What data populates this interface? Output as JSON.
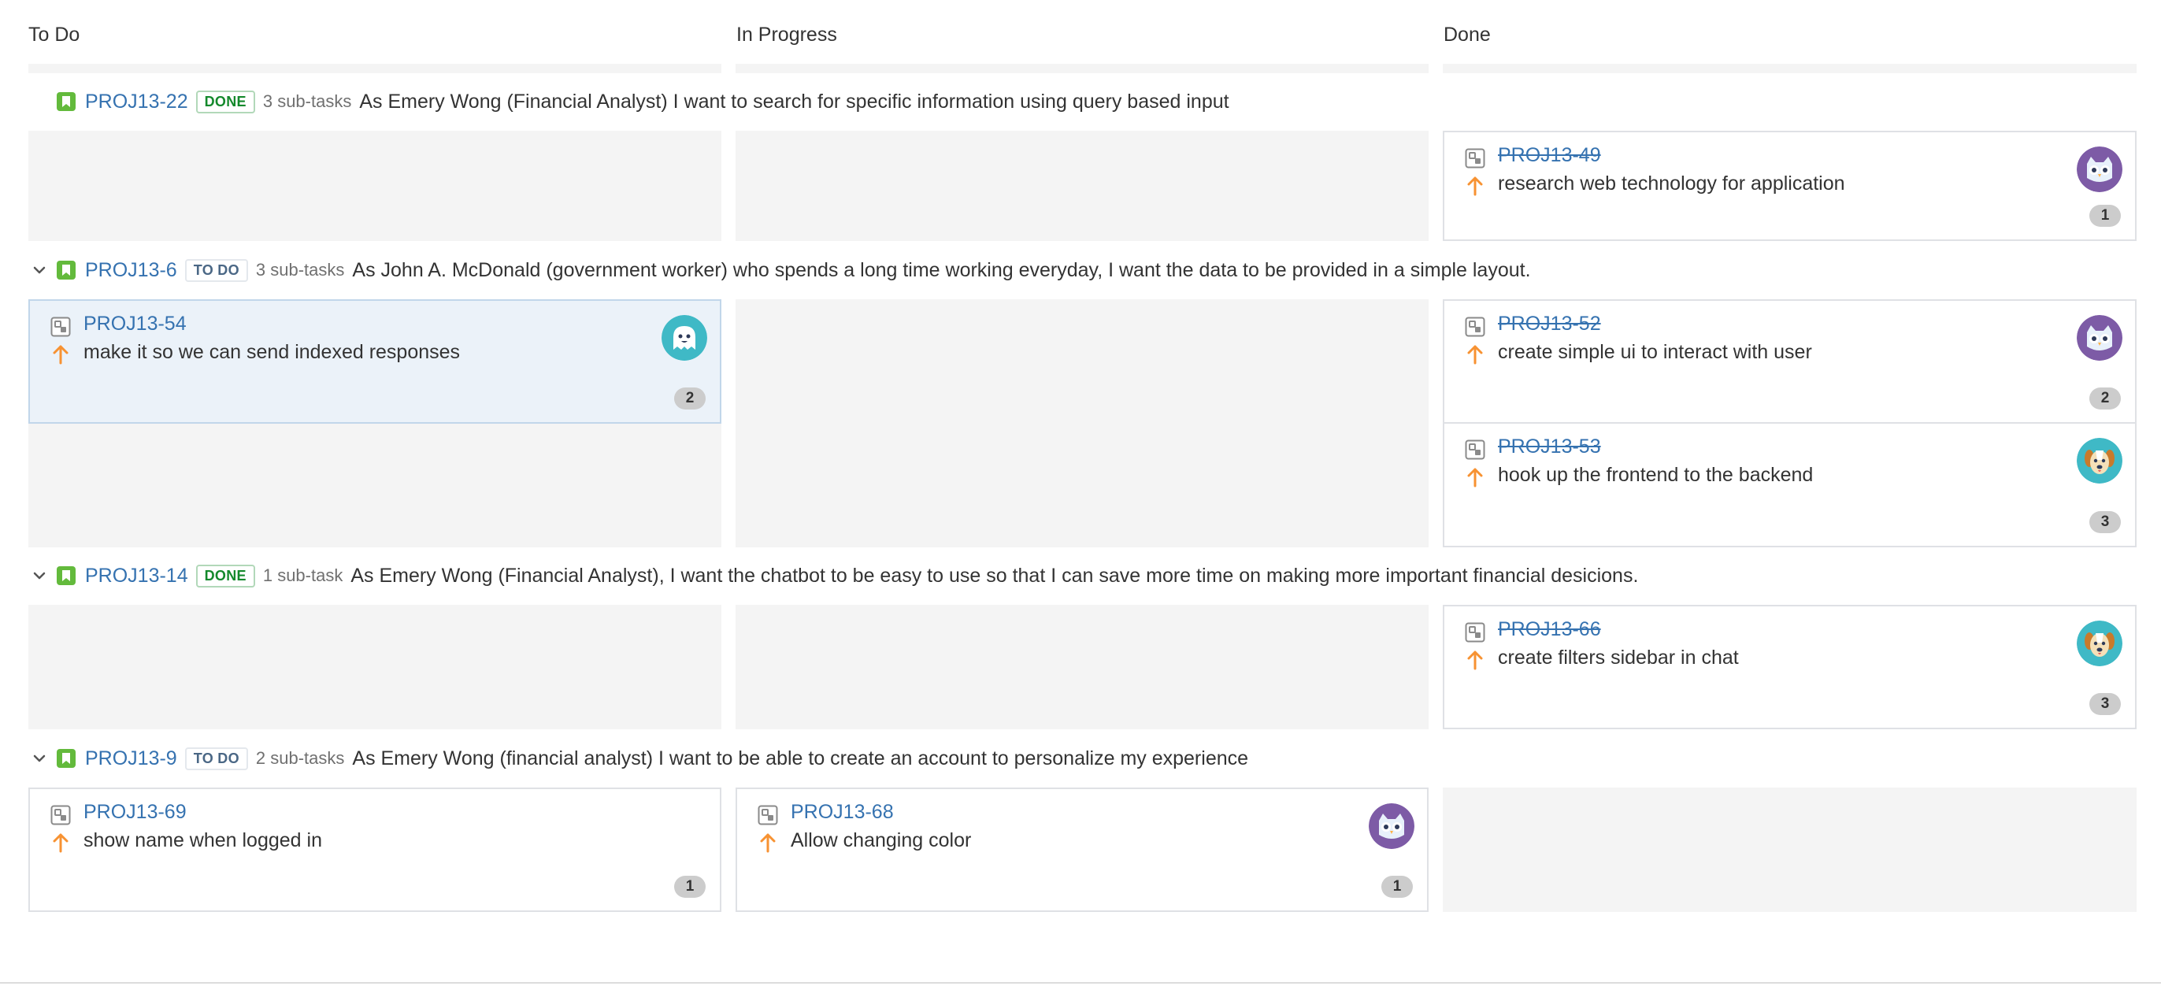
{
  "columns": [
    "To Do",
    "In Progress",
    "Done"
  ],
  "swimlanes": [
    {
      "key": "PROJ13-22",
      "status": "DONE",
      "subtasks": "3 sub-tasks",
      "summary": "As Emery Wong (Financial Analyst) I want to search for specific information using query based input",
      "cards": [
        {
          "key": "PROJ13-49",
          "summary": "research web technology for application",
          "estimate": "1",
          "column": "Done",
          "key_strikethrough": true,
          "avatar": "owl-avatar-purple"
        }
      ]
    },
    {
      "key": "PROJ13-6",
      "status": "TO DO",
      "subtasks": "3 sub-tasks",
      "summary": "As John A. McDonald (government worker) who spends a long time working everyday, I want the data to be provided in a simple layout.",
      "cards": [
        {
          "key": "PROJ13-54",
          "summary": "make it so we can send indexed responses",
          "estimate": "2",
          "column": "To Do",
          "key_strikethrough": false,
          "selected": true,
          "avatar": "ghost-avatar-teal"
        },
        {
          "key": "PROJ13-52",
          "summary": "create simple ui to interact with user",
          "estimate": "2",
          "column": "Done",
          "key_strikethrough": true,
          "avatar": "owl-avatar-purple"
        },
        {
          "key": "PROJ13-53",
          "summary": "hook up the frontend to the backend",
          "estimate": "3",
          "column": "Done",
          "key_strikethrough": true,
          "avatar": "dog-avatar-teal"
        }
      ]
    },
    {
      "key": "PROJ13-14",
      "status": "DONE",
      "subtasks": "1 sub-task",
      "summary": "As Emery Wong (Financial Analyst), I want the chatbot to be easy to use so that I can save more time on making more important financial desicions.",
      "cards": [
        {
          "key": "PROJ13-66",
          "summary": "create filters sidebar in chat",
          "estimate": "3",
          "column": "Done",
          "key_strikethrough": true,
          "avatar": "dog-avatar-teal"
        }
      ]
    },
    {
      "key": "PROJ13-9",
      "status": "TO DO",
      "subtasks": "2 sub-tasks",
      "summary": "As Emery Wong (financial analyst) I want to be able to create an account to personalize my experience",
      "cards": [
        {
          "key": "PROJ13-69",
          "summary": "show name when logged in",
          "estimate": "1",
          "column": "To Do",
          "key_strikethrough": false
        },
        {
          "key": "PROJ13-68",
          "summary": "Allow changing color",
          "estimate": "1",
          "column": "In Progress",
          "key_strikethrough": false,
          "avatar": "owl-avatar-purple"
        }
      ]
    }
  ],
  "icons": {
    "chevron": "chevron-down-icon",
    "story": "story-icon",
    "subtask": "subtask-icon",
    "priority": "priority-high-arrow-icon"
  },
  "colors": {
    "link": "#3572b0",
    "story_green": "#63ba3c",
    "priority_orange": "#f79232",
    "done_lozenge": "#14892c",
    "todo_lozenge": "#4a6785",
    "avatar_purple": "#7d5ba6",
    "avatar_teal": "#3fb9c6"
  }
}
